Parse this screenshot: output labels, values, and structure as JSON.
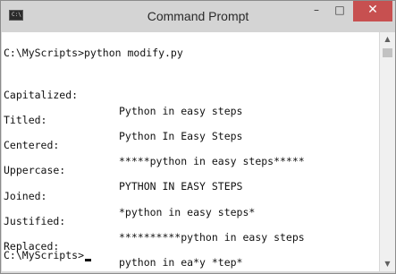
{
  "window": {
    "title": "Command Prompt",
    "icon": "cmd-console-icon",
    "icon_text": "C:\\",
    "controls": {
      "minimize": "–",
      "maximize": "□",
      "close": "✕"
    }
  },
  "console": {
    "command_line": "C:\\MyScripts>python modify.py",
    "rows": [
      {
        "label": "Capitalized:",
        "value": "Python in easy steps"
      },
      {
        "label": "Titled:",
        "value": "Python In Easy Steps"
      },
      {
        "label": "Centered:",
        "value": "*****python in easy steps*****"
      },
      {
        "label": "Uppercase:",
        "value": "PYTHON IN EASY STEPS"
      },
      {
        "label": "Joined:",
        "value": "*python in easy steps*"
      },
      {
        "label": "Justified:",
        "value": "**********python in easy steps"
      },
      {
        "label": "Replaced:",
        "value": "python in ea*y *tep*"
      }
    ],
    "prompt": "C:\\MyScripts>"
  },
  "scrollbar": {
    "up_arrow": "▲",
    "down_arrow": "▼"
  }
}
